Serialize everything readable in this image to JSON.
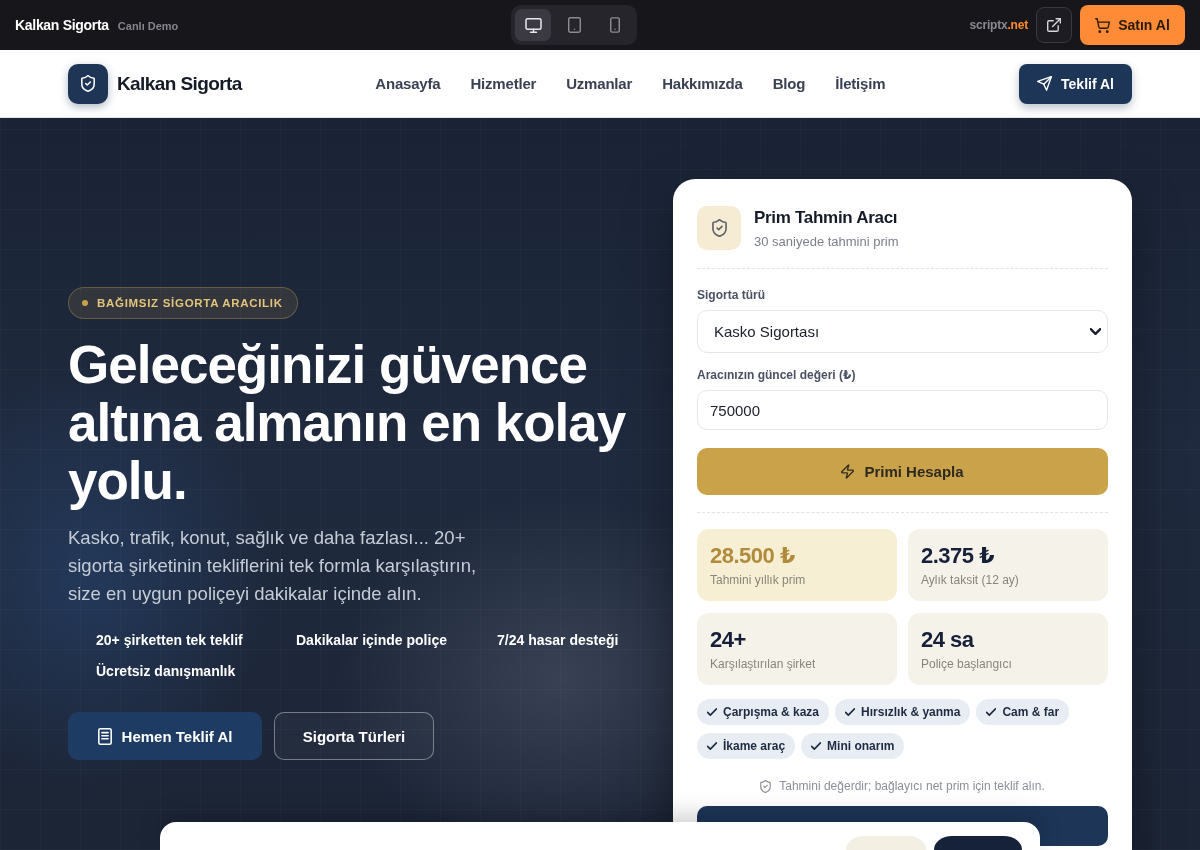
{
  "demo_bar": {
    "title": "Kalkan Sigorta",
    "subtitle": "Canlı Demo",
    "devices": [
      {
        "kind": "desktop",
        "selected": true
      },
      {
        "kind": "tablet",
        "selected": false
      },
      {
        "kind": "phone",
        "selected": false
      }
    ],
    "site": {
      "name": "scriptx",
      "suffix": ".net"
    },
    "buy_button": "Satın Al"
  },
  "navbar": {
    "brand": "Kalkan Sigorta",
    "links": [
      "Anasayfa",
      "Hizmetler",
      "Uzmanlar",
      "Hakkımızda",
      "Blog",
      "İletişim"
    ],
    "cta": "Teklif Al"
  },
  "hero": {
    "badge": "BAĞIMSIZ SİGORTA ARACILIK",
    "title": "Geleceğinizi güvence altına almanın en kolay yolu.",
    "description": "Kasko, trafik, konut, sağlık ve daha fazlası... 20+ sigorta şirketinin tekliflerini tek formla karşılaştırın, size en uygun poliçeyi dakikalar içinde alın.",
    "features": [
      "20+ şirketten tek teklif",
      "Dakikalar içinde poliçe",
      "7/24 hasar desteği",
      "Ücretsiz danışmanlık"
    ],
    "buttons": [
      {
        "kind": "primary",
        "label": "Hemen Teklif Al"
      },
      {
        "kind": "outline",
        "label": "Sigorta Türleri"
      }
    ]
  },
  "estimator": {
    "title": "Prim Tahmin Aracı",
    "subtitle": "30 saniyede tahmini prim",
    "fields": [
      {
        "kind": "select",
        "label": "Sigorta türü",
        "value": "Kasko Sigortası"
      },
      {
        "kind": "input",
        "label": "Aracınızın güncel değeri (₺)",
        "value": "750000"
      }
    ],
    "submit": "Primi Hesapla",
    "stats": [
      {
        "value": "28.500 ₺",
        "label": "Tahmini yıllık prim",
        "highlighted": true
      },
      {
        "value": "2.375 ₺",
        "label": "Aylık taksit (12 ay)",
        "highlighted": false
      },
      {
        "value": "24+",
        "label": "Karşılaştırılan şirket",
        "highlighted": false
      },
      {
        "value": "24 sa",
        "label": "Poliçe başlangıcı",
        "highlighted": false
      }
    ],
    "coverages": [
      "Çarpışma & kaza",
      "Hırsızlık & yanma",
      "Cam & far",
      "İkame araç",
      "Mini onarım"
    ],
    "note": "Tahmini değerdir; bağlayıcı net prim için teklif alın."
  },
  "cookie_banner": {
    "buttons": [
      {
        "kind": "secondary"
      },
      {
        "kind": "primary"
      }
    ]
  }
}
